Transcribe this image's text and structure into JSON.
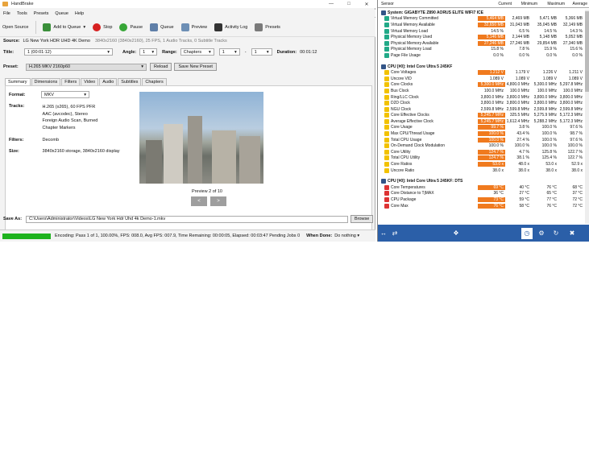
{
  "handbrake": {
    "title": "HandBrake",
    "menu": [
      "File",
      "Tools",
      "Presets",
      "Queue",
      "Help"
    ],
    "toolbar": [
      "Open Source",
      "Add to Queue",
      "Stop",
      "Pause",
      "Queue",
      "Preview",
      "Activity Log",
      "Presets"
    ],
    "source_label": "Source:",
    "source_value": "LG New York HDR UHD 4K Demo",
    "source_info": "3840x2160 (3840x2160), 25 FPS, 1 Audio Tracks, 0 Subtitle Tracks",
    "title_label": "Title:",
    "title_value": "1 (00:01:12)",
    "angle_label": "Angle:",
    "angle_value": "1",
    "range_label": "Range:",
    "range_value": "Chapters",
    "range_start": "1",
    "range_sep": "-",
    "range_end": "1",
    "duration_label": "Duration:",
    "duration_value": "00:01:12",
    "preset_label": "Preset:",
    "preset_value": "H.265 MKV 2160p60",
    "reload_label": "Reload",
    "save_preset_label": "Save New Preset",
    "tabs": [
      "Summary",
      "Dimensions",
      "Filters",
      "Video",
      "Audio",
      "Subtitles",
      "Chapters"
    ],
    "format_label": "Format:",
    "format_value": "MKV",
    "tracks_label": "Tracks:",
    "tracks": [
      "H.265 (x265), 60 FPS PFR",
      "AAC (avcodec), Stereo",
      "Foreign Audio Scan, Burned",
      "Chapter Markers"
    ],
    "filters_label": "Filters:",
    "filters_value": "Decomb",
    "size_label": "Size:",
    "size_value": "3840x2160 storage, 3840x2160 display",
    "preview_caption": "Preview 2 of 10",
    "prev_glyph": "<",
    "next_glyph": ">",
    "save_as_label": "Save As:",
    "save_as_value": "C:\\Users\\Administrator\\Videos\\LG New York Hdr Uhd 4k Demo-1.mkv",
    "browse_label": "Browse",
    "status_text": "Encoding: Pass 1 of 1,  100.00%, FPS: 008.0,  Avg FPS: 007.9,  Time Remaining: 00:00:05,  Elapsed: 00:03:47    Pending Jobs 0",
    "progress": 1.0,
    "when_done_label": "When Done:",
    "when_done_value": "Do nothing"
  },
  "hwinfo": {
    "headers": [
      "Sensor",
      "Current",
      "Minimum",
      "Maximum",
      "Average"
    ],
    "sections": [
      {
        "title": "System: GIGABYTE Z890 AORUS ELITE WIFI7 ICE",
        "rows": [
          [
            "Virtual Memory Committed",
            "5,464 MB",
            "2,469 MB",
            "5,471 MB",
            "5,366 MB",
            true
          ],
          [
            "Virtual Memory Available",
            "32,650 MB",
            "31,043 MB",
            "35,045 MB",
            "32,149 MB",
            true
          ],
          [
            "Virtual Memory Load",
            "14.5 %",
            "6.5 %",
            "14.5 %",
            "14.3 %",
            false
          ],
          [
            "Physical Memory Used",
            "5,146 MB",
            "2,144 MB",
            "5,148 MB",
            "5,052 MB",
            true
          ],
          [
            "Physical Memory Available",
            "27,246 MB",
            "27,246 MB",
            "29,854 MB",
            "27,340 MB",
            true
          ],
          [
            "Physical Memory Load",
            "15.8 %",
            "7.8 %",
            "15.9 %",
            "15.6 %",
            false
          ],
          [
            "Page File Usage",
            "0.0 %",
            "0.0 %",
            "0.0 %",
            "0.0 %",
            false
          ]
        ]
      },
      {
        "title": "CPU [#0]: Intel Core Ultra 5 245KF",
        "rows": [
          [
            "Core Voltages",
            "1.212 V",
            "1.179 V",
            "1.226 V",
            "1.211 V",
            true
          ],
          [
            "Uncore VID",
            "1.089 V",
            "1.089 V",
            "1.089 V",
            "1.089 V",
            false
          ],
          [
            "Core Clocks",
            "5,300.0 MHz",
            "4,800.0 MHz",
            "5,300.0 MHz",
            "5,297.8 MHz",
            true
          ],
          [
            "Bus Clock",
            "100.0 MHz",
            "100.0 MHz",
            "100.0 MHz",
            "100.0 MHz",
            false
          ],
          [
            "Ring/LLC Clock",
            "3,800.0 MHz",
            "3,800.0 MHz",
            "3,800.0 MHz",
            "3,800.0 MHz",
            false
          ],
          [
            "D2D Clock",
            "3,800.0 MHz",
            "3,800.0 MHz",
            "3,800.0 MHz",
            "3,800.0 MHz",
            false
          ],
          [
            "NGU Clock",
            "2,599.8 MHz",
            "2,599.8 MHz",
            "2,599.8 MHz",
            "2,599.8 MHz",
            false
          ],
          [
            "Core Effective Clocks",
            "5,245.7 MHz",
            "325.5 MHz",
            "5,275.9 MHz",
            "5,172.3 MHz",
            true
          ],
          [
            "Average Effective Clock",
            "5,245.7 MHz",
            "1,612.4 MHz",
            "5,288.2 MHz",
            "5,172.3 MHz",
            true
          ],
          [
            "Core Usage",
            "99.7 %",
            "3.8 %",
            "100.0 %",
            "97.6 %",
            true
          ],
          [
            "Max CPU/Thread Usage",
            "100.0 %",
            "43.4 %",
            "100.0 %",
            "98.7 %",
            true
          ],
          [
            "Total CPU Usage",
            "100.0 %",
            "27.4 %",
            "100.0 %",
            "97.6 %",
            true
          ],
          [
            "On-Demand Clock Modulation",
            "100.0 %",
            "100.0 %",
            "100.0 %",
            "100.0 %",
            false
          ],
          [
            "Core Utility",
            "124.7 %",
            "4.7 %",
            "125.8 %",
            "122.7 %",
            true
          ],
          [
            "Total CPU Utility",
            "124.7 %",
            "38.1 %",
            "125.4 %",
            "122.7 %",
            true
          ],
          [
            "Core Ratios",
            "53.0 x",
            "48.0 x",
            "53.0 x",
            "52.9 x",
            true
          ],
          [
            "Uncore Ratio",
            "38.0 x",
            "38.0 x",
            "38.0 x",
            "38.0 x",
            false
          ]
        ]
      },
      {
        "title": "CPU [#0]: Intel Core Ultra 5 245KF: DTS",
        "rows": [
          [
            "Core Temperatures",
            "69 °C",
            "40 °C",
            "76 °C",
            "68 °C",
            true
          ],
          [
            "Core Distance to TjMAX",
            "36 °C",
            "27 °C",
            "65 °C",
            "37 °C",
            false
          ],
          [
            "CPU Package",
            "73 °C",
            "59 °C",
            "77 °C",
            "72 °C",
            true
          ],
          [
            "Core Max",
            "76 °C",
            "58 °C",
            "76 °C",
            "72 °C",
            true
          ]
        ]
      }
    ],
    "footer_clock": "0:03:46",
    "brand": "AORUS"
  }
}
